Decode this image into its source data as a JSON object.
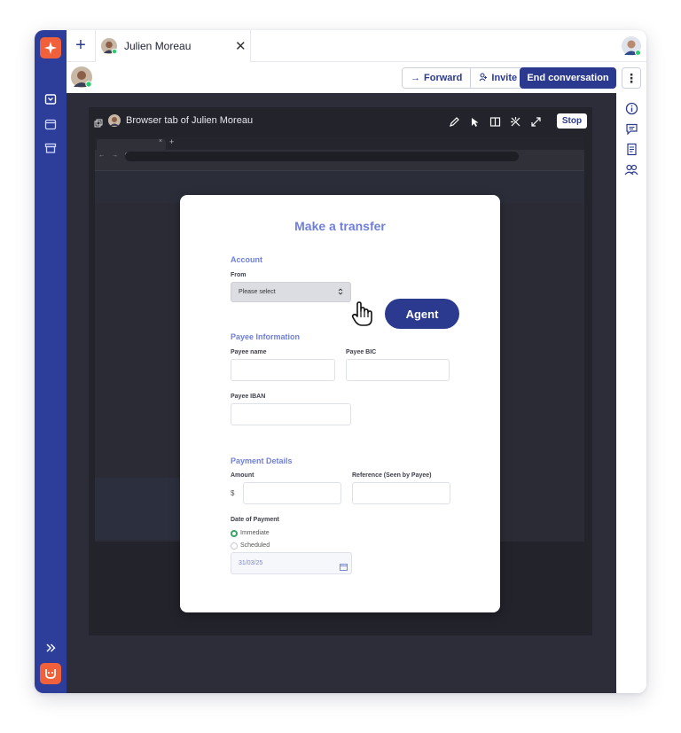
{
  "tabs": [
    {
      "label": "Julien Moreau",
      "close": "✕"
    }
  ],
  "new_tab": "+",
  "toolbar": {
    "forward": "Forward",
    "forward_arrow": "→",
    "invite": "Invite",
    "end": "End conversation",
    "more": "⋮"
  },
  "frame": {
    "title": "Browser tab of  Julien Moreau",
    "stop": "Stop"
  },
  "mini_browser": {
    "tab_close": "×",
    "new_tab": "+",
    "nav": "← → C"
  },
  "agent_label": "Agent",
  "form": {
    "title": "Make a transfer",
    "account_section": "Account",
    "from_label": "From",
    "from_value": "Please select",
    "payee_section": "Payee Information",
    "payee_name_label": "Payee name",
    "payee_bic_label": "Payee BIC",
    "payee_iban_label": "Payee IBAN",
    "payment_section": "Payment Details",
    "amount_label": "Amount",
    "currency": "$",
    "reference_label": "Reference (Seen by Payee)",
    "date_label": "Date of Payment",
    "radio_immediate": "Immediate",
    "radio_scheduled": "Scheduled",
    "date_value": "31/03/25",
    "selected_option": "Immediate"
  },
  "colors": {
    "rail": "#2c3d9a",
    "brand": "#f0603a",
    "primary": "#2b3a8f",
    "form_accent": "#6f7fd8",
    "online": "#2ecc71"
  },
  "icons": {
    "rail": [
      "inbox-icon",
      "calendar-icon",
      "archive-icon",
      "expand-icon"
    ],
    "right_rail": [
      "info-icon",
      "chat-icon",
      "notes-icon",
      "users-icon"
    ],
    "frame_controls": [
      "pen-icon",
      "pointer-icon",
      "dock-icon",
      "tools-off-icon",
      "fullscreen-icon"
    ]
  }
}
